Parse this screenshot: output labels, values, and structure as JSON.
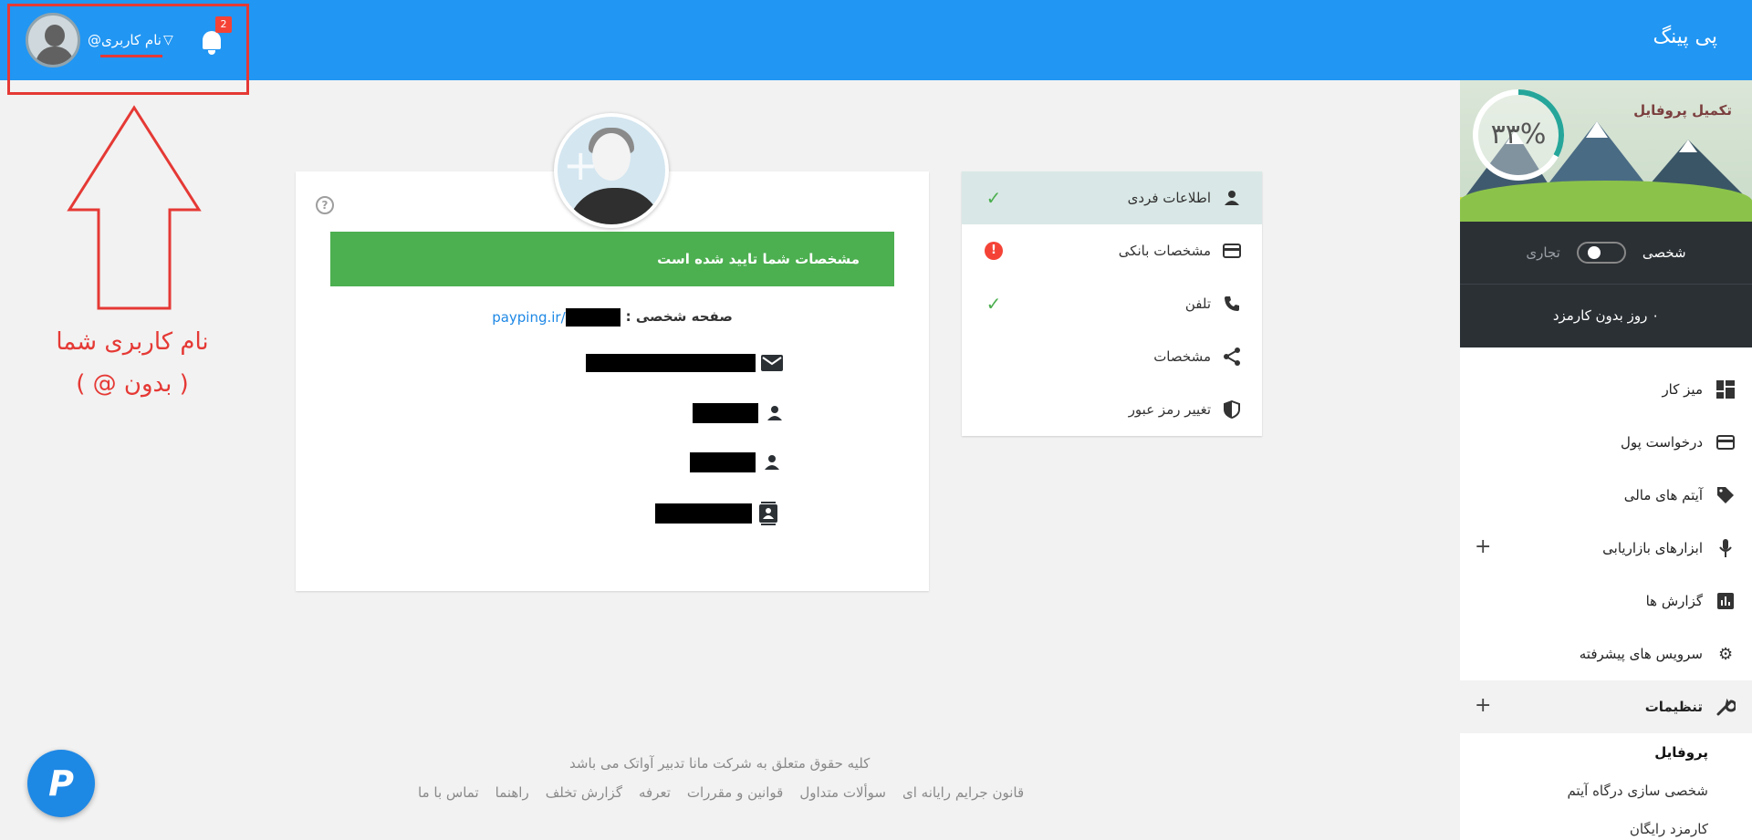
{
  "header": {
    "brand": "پی پینگ",
    "username": "نام کاربری@",
    "notification_count": "2"
  },
  "annotation": {
    "line1": "نام کاربری شما",
    "line2": "( بدون @ )"
  },
  "sidebar": {
    "profile_complete_title": "تکمیل پروفایل",
    "profile_complete_percent_text": "۳۳%",
    "profile_complete_fraction": 0.33,
    "account_type_business": "تجاری",
    "account_type_personal": "شخصی",
    "fee_free_text": "۰ روز بدون کارمزد",
    "menu": [
      {
        "label": "میز کار",
        "icon": "dashboard-icon"
      },
      {
        "label": "درخواست پول",
        "icon": "credit-card-icon"
      },
      {
        "label": "آیتم های مالی",
        "icon": "tag-icon"
      },
      {
        "label": "ابزارهای بازاریابی",
        "icon": "microphone-icon",
        "expandable": true
      },
      {
        "label": "گزارش ها",
        "icon": "bar-chart-icon"
      },
      {
        "label": "سرویس های پیشرفته",
        "icon": "gear-icon"
      },
      {
        "label": "تنظیمات",
        "icon": "wrench-icon",
        "expandable": true
      }
    ],
    "submenu": [
      {
        "label": "پروفایل"
      },
      {
        "label": "شخصی سازی درگاه آیتم"
      },
      {
        "label": "کارمزد رایگان"
      }
    ]
  },
  "profile_tabs": [
    {
      "label": "اطلاعات فردی",
      "icon": "person-icon",
      "status": "ok"
    },
    {
      "label": "مشخصات بانکی",
      "icon": "credit-card-icon",
      "status": "error"
    },
    {
      "label": "تلفن",
      "icon": "phone-icon",
      "status": "ok"
    },
    {
      "label": "مشخصات",
      "icon": "share-icon",
      "status": ""
    },
    {
      "label": "تغییر رمز عبور",
      "icon": "shield-icon",
      "status": ""
    }
  ],
  "card": {
    "verify_text": "مشخصات شما تایید شده است",
    "profile_page_label": "صفحه شخصی :",
    "profile_link_prefix": "payping.ir/",
    "help_glyph": "?"
  },
  "footer": {
    "copyright": "کلیه حقوق متعلق به شرکت مانا تدبیر آواتک می باشد",
    "links": [
      "قانون جرایم رایانه ای",
      "سوألات متداول",
      "قوانین و مقررات",
      "تعرفه",
      "گزارش تخلف",
      "راهنما",
      "تماس با ما"
    ]
  },
  "fab": {
    "label": "P"
  },
  "colors": {
    "primary": "#2196f3",
    "success": "#4caf50",
    "error": "#f44336",
    "sidebar_dark": "#2b3035",
    "annotation": "#e53935"
  }
}
